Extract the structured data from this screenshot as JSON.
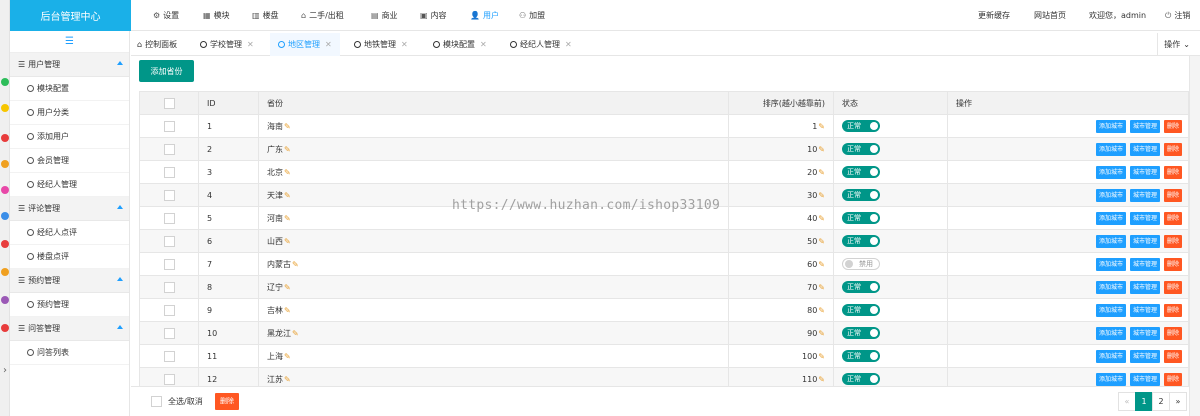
{
  "logo": {
    "text": "后台管理中心"
  },
  "topnav": {
    "items": [
      {
        "label": "设置",
        "icon": "gear-icon",
        "glyph": "⚙"
      },
      {
        "label": "模块",
        "icon": "module-icon",
        "glyph": "▦"
      },
      {
        "label": "楼盘",
        "icon": "building-icon",
        "glyph": "▥"
      },
      {
        "label": "二手/出租",
        "icon": "house-icon",
        "glyph": "⌂"
      },
      {
        "label": "商业",
        "icon": "shop-icon",
        "glyph": "▤"
      },
      {
        "label": "内容",
        "icon": "content-icon",
        "glyph": "▣"
      },
      {
        "label": "用户",
        "icon": "user-icon",
        "glyph": "👤"
      },
      {
        "label": "加盟",
        "icon": "join-icon",
        "glyph": "⚇"
      }
    ],
    "active": "用户",
    "right": {
      "update_cache": "更新缓存",
      "site_home": "网站首页",
      "welcome": "欢迎您，admin",
      "logout": "注销",
      "logout_glyph": "⏻"
    }
  },
  "sidebar": {
    "toggle_glyph": "☰",
    "groups": [
      {
        "title": "用户管理",
        "items": [
          "模块配置",
          "用户分类",
          "添加用户",
          "会员管理",
          "经纪人管理"
        ]
      },
      {
        "title": "评论管理",
        "items": [
          "经纪人点评",
          "楼盘点评"
        ]
      },
      {
        "title": "预约管理",
        "items": [
          "预约管理"
        ]
      },
      {
        "title": "问答管理",
        "items": [
          "问答列表"
        ]
      }
    ]
  },
  "tabs": {
    "items": [
      {
        "label": "控制面板",
        "closable": false,
        "active": false
      },
      {
        "label": "学校管理",
        "closable": true,
        "active": false
      },
      {
        "label": "地区管理",
        "closable": true,
        "active": true
      },
      {
        "label": "地铁管理",
        "closable": true,
        "active": false
      },
      {
        "label": "模块配置",
        "closable": true,
        "active": false
      },
      {
        "label": "经纪人管理",
        "closable": true,
        "active": false
      }
    ],
    "close_glyph": "✕",
    "ops_label": "操作"
  },
  "toolbar": {
    "add_province": "添加省份"
  },
  "table": {
    "headers": {
      "id": "ID",
      "province": "省份",
      "sort": "排序(越小越靠前)",
      "status": "状态",
      "actions": "操作"
    },
    "rows": [
      {
        "id": "1",
        "province": "海南",
        "sort": "1",
        "status": "正常",
        "enabled": true
      },
      {
        "id": "2",
        "province": "广东",
        "sort": "10",
        "status": "正常",
        "enabled": true
      },
      {
        "id": "3",
        "province": "北京",
        "sort": "20",
        "status": "正常",
        "enabled": true
      },
      {
        "id": "4",
        "province": "天津",
        "sort": "30",
        "status": "正常",
        "enabled": true
      },
      {
        "id": "5",
        "province": "河南",
        "sort": "40",
        "status": "正常",
        "enabled": true
      },
      {
        "id": "6",
        "province": "山西",
        "sort": "50",
        "status": "正常",
        "enabled": true
      },
      {
        "id": "7",
        "province": "内蒙古",
        "sort": "60",
        "status": "禁用",
        "enabled": false
      },
      {
        "id": "8",
        "province": "辽宁",
        "sort": "70",
        "status": "正常",
        "enabled": true
      },
      {
        "id": "9",
        "province": "吉林",
        "sort": "80",
        "status": "正常",
        "enabled": true
      },
      {
        "id": "10",
        "province": "黑龙江",
        "sort": "90",
        "status": "正常",
        "enabled": true
      },
      {
        "id": "11",
        "province": "上海",
        "sort": "100",
        "status": "正常",
        "enabled": true
      },
      {
        "id": "12",
        "province": "江苏",
        "sort": "110",
        "status": "正常",
        "enabled": true
      }
    ],
    "action_labels": {
      "add_city": "添加城市",
      "city_manage": "城市管理",
      "delete": "删除"
    },
    "edit_glyph": "✎"
  },
  "footer": {
    "select_all": "全选/取消",
    "delete": "删除",
    "pager": {
      "prev": "«",
      "pages": [
        "1",
        "2"
      ],
      "current": "1",
      "next": "»"
    }
  },
  "watermark": "https://www.huzhan.com/ishop33109",
  "colors": {
    "accent": "#1e9fff",
    "primary": "#009688",
    "danger": "#ff5722",
    "logo_bg": "#1ab0e8"
  }
}
